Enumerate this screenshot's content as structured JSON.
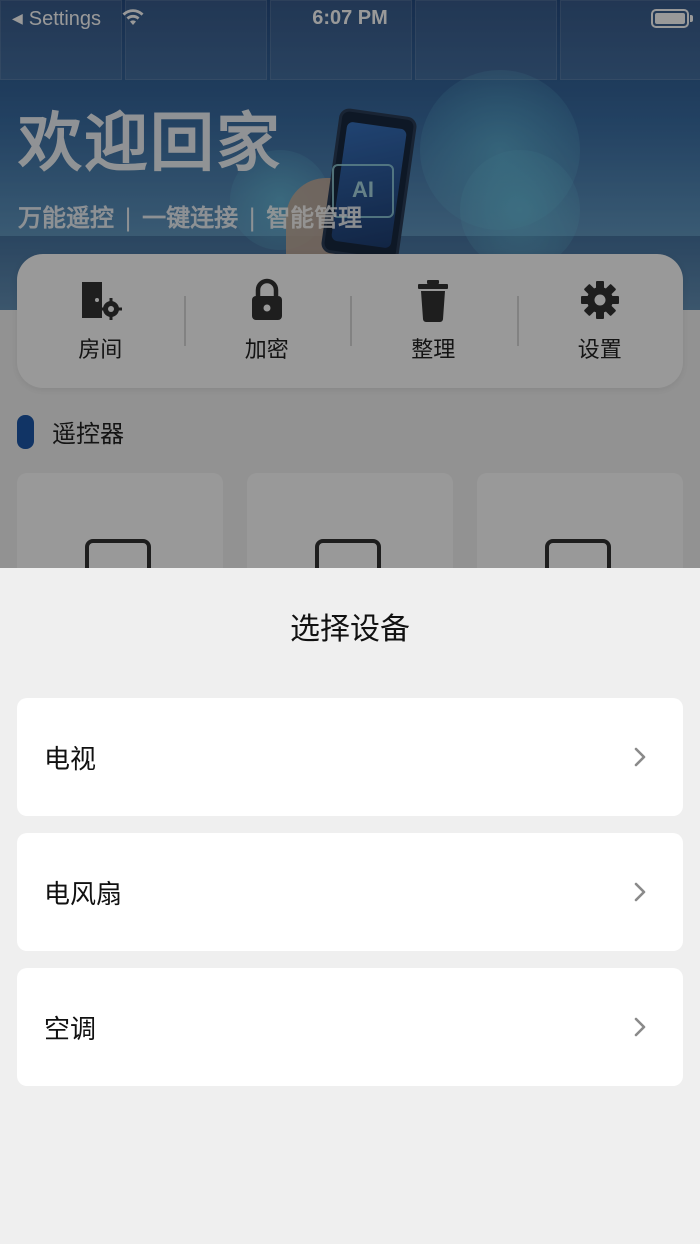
{
  "status_bar": {
    "back_label": "Settings",
    "time": "6:07 PM"
  },
  "hero": {
    "welcome": "欢迎回家",
    "tagline": [
      "万能遥控",
      "一键连接",
      "智能管理"
    ],
    "separator": "|",
    "image_badge": "AI"
  },
  "quick_actions": [
    {
      "label": "房间",
      "icon": "room-settings-icon"
    },
    {
      "label": "加密",
      "icon": "lock-icon"
    },
    {
      "label": "整理",
      "icon": "trash-icon"
    },
    {
      "label": "设置",
      "icon": "gear-icon"
    }
  ],
  "section": {
    "title": "遥控器",
    "accent_color": "#1d58a8"
  },
  "remote_cards": [
    {
      "icon": "tv-remote-icon"
    },
    {
      "icon": "fan-remote-icon"
    },
    {
      "icon": "air-conditioner-remote-icon"
    }
  ],
  "sheet": {
    "title": "选择设备",
    "devices": [
      {
        "label": "电视"
      },
      {
        "label": "电风扇"
      },
      {
        "label": "空调"
      }
    ]
  },
  "colors": {
    "overlay": "rgba(0,0,0,0.40)",
    "sheet_background": "#efefef",
    "row_background": "#ffffff",
    "chevron": "#8a8a8a"
  }
}
